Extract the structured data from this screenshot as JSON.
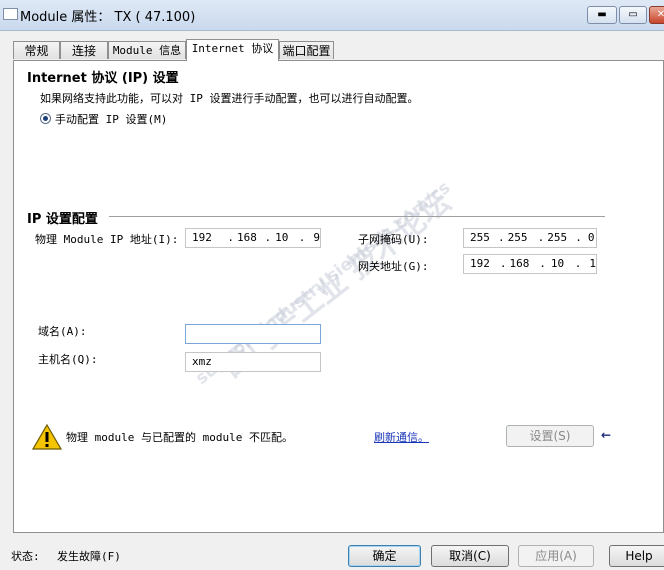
{
  "window": {
    "title": "Module 属性： TX ( 47.100)",
    "minimize_glyph": "▬",
    "maximize_glyph": "▭",
    "close_glyph": "✕"
  },
  "tabs": [
    {
      "label": "常规"
    },
    {
      "label": "连接"
    },
    {
      "label": "Module 信息"
    },
    {
      "label": "Internet 协议"
    },
    {
      "label": "端口配置"
    }
  ],
  "internet": {
    "section_title": "Internet 协议 (IP) 设置",
    "description": "如果网络支持此功能，可以对 IP 设置进行手动配置，也可以进行自动配置。",
    "manual_option": "手动配置 IP 设置(M)"
  },
  "ip_config": {
    "section_title": "IP 设置配置",
    "module_ip_label": "物理 Module IP 地址(I):",
    "module_ip": [
      "192",
      "168",
      "10",
      "9"
    ],
    "subnet_label": "子网掩码(U):",
    "subnet": [
      "255",
      "255",
      "255",
      "0"
    ],
    "gateway_label": "网关地址(G):",
    "gateway": [
      "192",
      "168",
      "10",
      "1"
    ],
    "domain_label": "域名(A):",
    "domain_value": "",
    "host_label": "主机名(Q):",
    "host_value": "xmz"
  },
  "status_msg": {
    "warning_text": "物理 module 与已配置的 module 不匹配。",
    "refresh_link": "刷新通信。",
    "settings_button": "设置(S)",
    "arrow_glyph": "←"
  },
  "footer": {
    "status_label": "状态:",
    "status_value": "发生故障(F)",
    "ok_button": "确定",
    "cancel_button": "取消(C)",
    "apply_button": "应用(A)",
    "help_button": "Help"
  },
  "watermark": {
    "line1": "西门子工业 技术论坛",
    "line2": "support.industry.siemens.com/cs"
  },
  "colors": {
    "link": "#1a36b8",
    "warning_yellow": "#f5c400"
  }
}
